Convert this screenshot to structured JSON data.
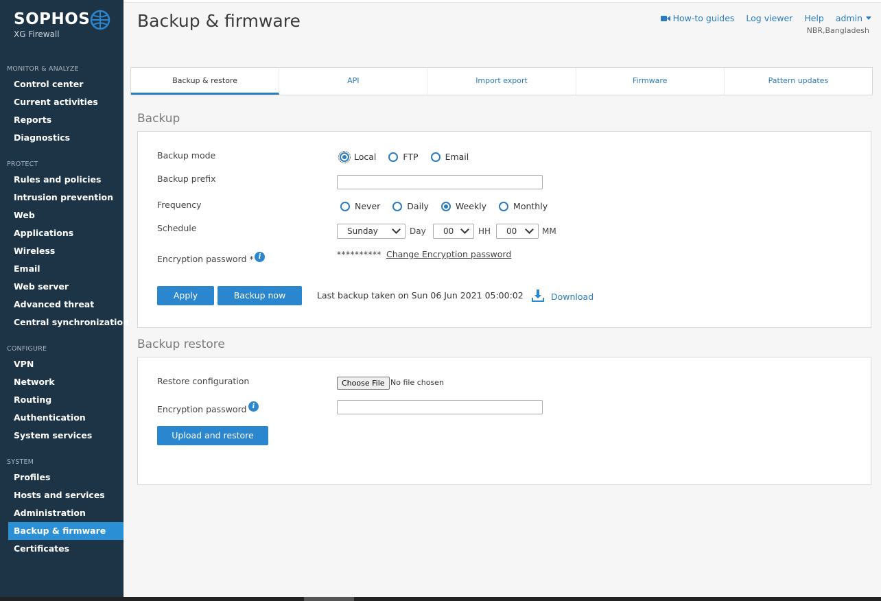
{
  "brand": {
    "name": "SOPHOS",
    "product": "XG Firewall"
  },
  "sidebar": {
    "sections": [
      {
        "title": "MONITOR & ANALYZE",
        "items": [
          "Control center",
          "Current activities",
          "Reports",
          "Diagnostics"
        ]
      },
      {
        "title": "PROTECT",
        "items": [
          "Rules and policies",
          "Intrusion prevention",
          "Web",
          "Applications",
          "Wireless",
          "Email",
          "Web server",
          "Advanced threat",
          "Central synchronization"
        ]
      },
      {
        "title": "CONFIGURE",
        "items": [
          "VPN",
          "Network",
          "Routing",
          "Authentication",
          "System services"
        ]
      },
      {
        "title": "SYSTEM",
        "items": [
          "Profiles",
          "Hosts and services",
          "Administration",
          "Backup & firmware",
          "Certificates"
        ]
      }
    ],
    "active_item": "Backup & firmware"
  },
  "header": {
    "title": "Backup & firmware",
    "links": {
      "howto": "How-to guides",
      "log_viewer": "Log viewer",
      "help": "Help",
      "user": "admin"
    },
    "location": "NBR,Bangladesh"
  },
  "tabs": [
    "Backup & restore",
    "API",
    "Import export",
    "Firmware",
    "Pattern updates"
  ],
  "active_tab": "Backup & restore",
  "backup": {
    "section_title": "Backup",
    "mode_label": "Backup mode",
    "modes": [
      "Local",
      "FTP",
      "Email"
    ],
    "mode_selected": "Local",
    "prefix_label": "Backup prefix",
    "prefix_value": "",
    "frequency_label": "Frequency",
    "frequencies": [
      "Never",
      "Daily",
      "Weekly",
      "Monthly"
    ],
    "frequency_selected": "Weekly",
    "schedule_label": "Schedule",
    "schedule_day": "Sunday",
    "day_unit": "Day",
    "schedule_hour": "00",
    "hour_unit": "HH",
    "schedule_minute": "00",
    "minute_unit": "MM",
    "enc_label": "Encryption password *",
    "enc_masked": "**********",
    "change_enc_link": "Change Encryption password",
    "apply_label": "Apply",
    "backup_now_label": "Backup now",
    "last_backup": "Last backup taken on Sun 06 Jun 2021 05:00:02",
    "download_label": "Download"
  },
  "restore": {
    "section_title": "Backup restore",
    "config_label": "Restore configuration",
    "choose_file_label": "Choose File",
    "no_file_text": "No file chosen",
    "enc_label": "Encryption password",
    "enc_value": "",
    "upload_label": "Upload and restore"
  },
  "colors": {
    "sidebar_bg": "#1d3446",
    "accent": "#2a86cf",
    "active_nav": "#2b8fd6"
  },
  "icons": {
    "camera": "video-camera-icon",
    "info": "info-icon",
    "download": "download-icon",
    "logo": "globe-icon"
  }
}
